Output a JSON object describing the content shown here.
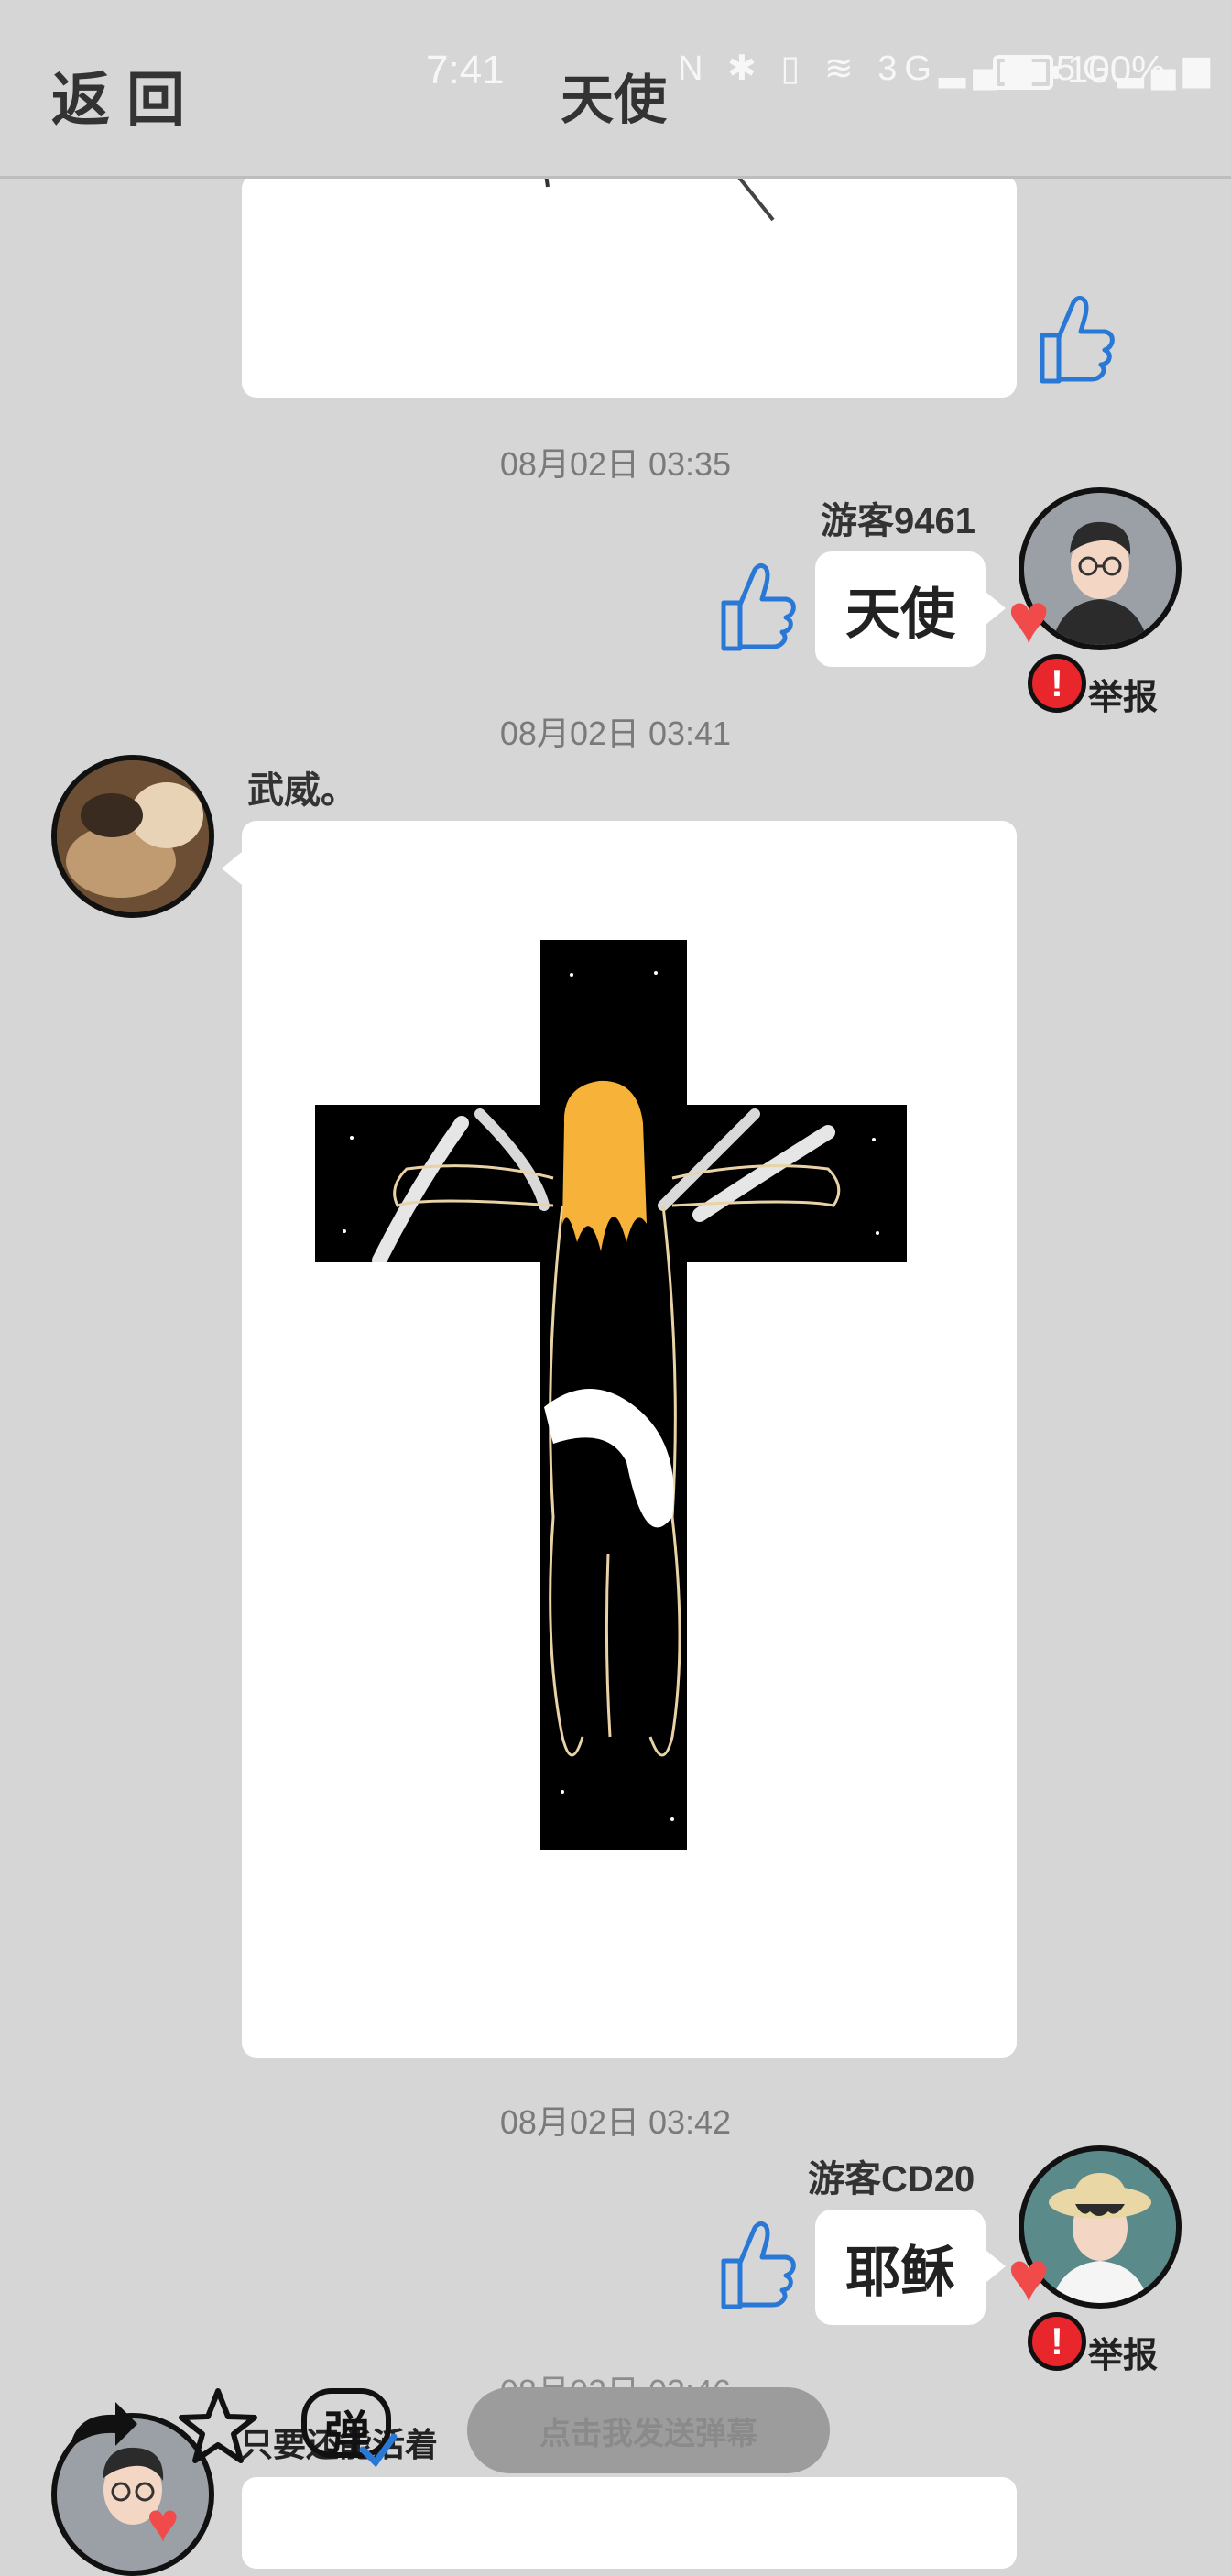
{
  "header": {
    "back_label": "返回",
    "title": "天使",
    "status_time": "7:41",
    "status_icons": "N ✱ ▯ ≋ 3G▂▄▆ 5G▂▄▆",
    "battery_pct": "100%"
  },
  "messages": [
    {
      "timestamp": "08月02日 03:35",
      "user": "游客9461",
      "text": "天使",
      "report": "举报"
    },
    {
      "timestamp": "08月02日 03:41",
      "user": "武威。",
      "content": "image"
    },
    {
      "timestamp": "08月02日 03:42",
      "user": "游客CD20",
      "text": "耶稣",
      "report": "举报"
    },
    {
      "timestamp": "08月02日 03:46"
    }
  ],
  "footer": {
    "danmaku_ticker": "只要还能活着",
    "danmaku_icon_char": "弹",
    "send_danmaku_label": "点击我发送弹幕"
  },
  "colors": {
    "background": "#d6d6d6",
    "like_blue": "#2a78d6",
    "heart_red": "#f04a4a",
    "report_red": "#e8262b"
  }
}
